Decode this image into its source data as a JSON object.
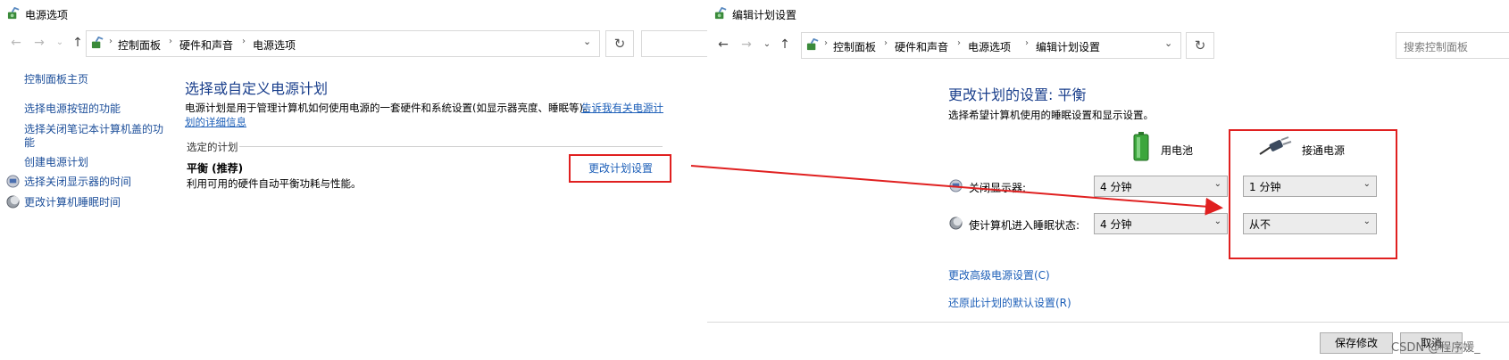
{
  "left_window": {
    "title": "电源选项",
    "breadcrumb": [
      "控制面板",
      "硬件和声音",
      "电源选项"
    ],
    "sidebar": {
      "home": "控制面板主页",
      "items": [
        {
          "label": "选择电源按钮的功能"
        },
        {
          "label": "选择关闭笔记本计算机盖的功"
        },
        {
          "label": "能"
        },
        {
          "label": "创建电源计划"
        },
        {
          "label": "选择关闭显示器的时间"
        },
        {
          "label": "更改计算机睡眠时间"
        }
      ]
    },
    "main": {
      "heading": "选择或自定义电源计划",
      "desc": "电源计划是用于管理计算机如何使用电源的一套硬件和系统设置(如显示器亮度、睡眠等)。",
      "desc_link_1": "告诉我有关电源计",
      "desc_link_2": "划的详细信息",
      "section_label": "选定的计划",
      "plan_name": "平衡 (推荐)",
      "plan_desc": "利用可用的硬件自动平衡功耗与性能。",
      "change_link": "更改计划设置"
    }
  },
  "right_window": {
    "title": "编辑计划设置",
    "breadcrumb": [
      "控制面板",
      "硬件和声音",
      "电源选项",
      "编辑计划设置"
    ],
    "search_placeholder": "搜索控制面板",
    "main": {
      "heading": "更改计划的设置: 平衡",
      "subheading": "选择希望计算机使用的睡眠设置和显示设置。",
      "col_battery": "用电池",
      "col_plugged": "接通电源",
      "rows": [
        {
          "label": "关闭显示器:",
          "battery": "4 分钟",
          "plugged": "1 分钟"
        },
        {
          "label": "使计算机进入睡眠状态:",
          "battery": "4 分钟",
          "plugged": "从不"
        }
      ],
      "advanced_link": "更改高级电源设置(C)",
      "restore_link": "还原此计划的默认设置(R)"
    },
    "buttons": {
      "save": "保存修改",
      "cancel": "取消"
    }
  },
  "watermark": "CSDN @程序媛_",
  "colors": {
    "link": "#1d5fb8",
    "heading": "#1a3f8c",
    "annotation": "#e02020"
  }
}
